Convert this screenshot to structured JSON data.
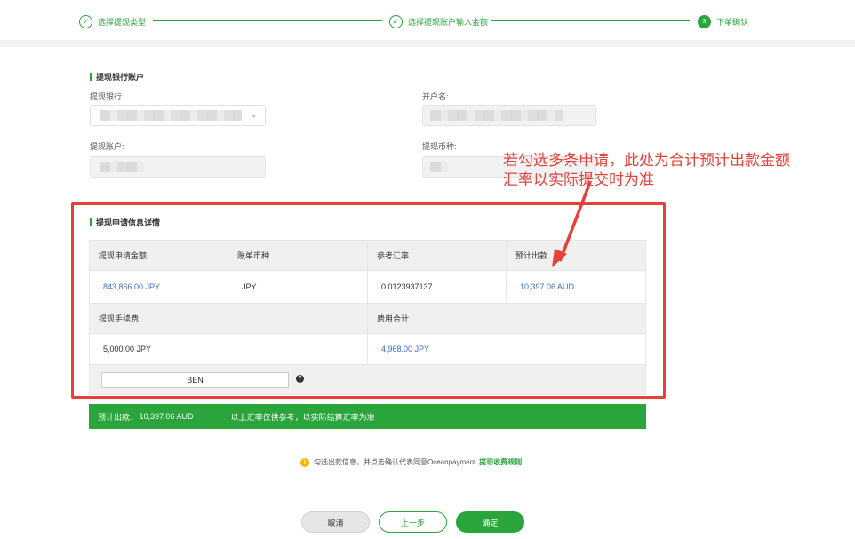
{
  "stepper": {
    "steps": [
      {
        "label": "选择提现类型",
        "icon": "check-icon"
      },
      {
        "label": "选择提现账户输入金额",
        "icon": "check-icon"
      },
      {
        "label": "下单确认",
        "number": "3"
      }
    ]
  },
  "bank_section": {
    "title": "提现银行账户",
    "bank_label": "提现银行",
    "account_name_label": "开户名:",
    "account_no_label": "提现账户:",
    "currency_label": "提现币种:"
  },
  "detail_section": {
    "title": "提现申请信息详情",
    "headers": [
      "提现申请金额",
      "账单币种",
      "参考汇率",
      "预计出款"
    ],
    "values": [
      "843,866.00 JPY",
      "JPY",
      "0.0123937137",
      "10,397.06 AUD"
    ],
    "fee_headers": [
      "提现手续费",
      "费用合计"
    ],
    "fee_values": [
      "5,000.00 JPY",
      "4,968.00 JPY"
    ],
    "ben_value": "BEN",
    "help_glyph": "?"
  },
  "annotation": {
    "line1": "若勾选多条申请，此处为合计预计出款金额",
    "line2": "汇率以实际提交时为准",
    "color": "#e5403a"
  },
  "banner": {
    "label": "预计出款:",
    "amount": "10,397.06 AUD",
    "note": "以上汇率仅供参考，以实际结算汇率为准"
  },
  "notice": {
    "glyph": "i",
    "text": "勾选出款信息，并点击确认代表同意Oceanpayment",
    "link": "提现收费规则"
  },
  "buttons": {
    "cancel": "取消",
    "prev": "上一步",
    "confirm": "确定"
  },
  "colors": {
    "accent": "#2aa53c",
    "link_blue": "#3d6fc9"
  }
}
